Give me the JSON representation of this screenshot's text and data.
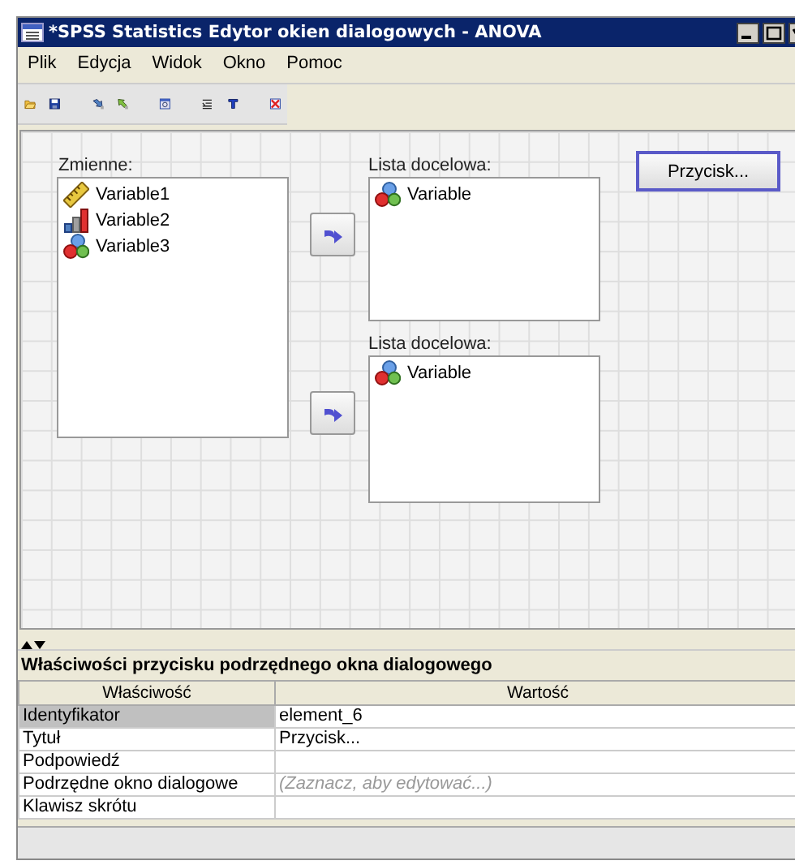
{
  "window": {
    "title": "*SPSS Statistics Edytor okien dialogowych - ANOVA"
  },
  "menu": [
    "Plik",
    "Edycja",
    "Widok",
    "Okno",
    "Pomoc"
  ],
  "canvas": {
    "source_list": {
      "label": "Zmienne:",
      "items": [
        {
          "text": "Variable1",
          "kind": "scale"
        },
        {
          "text": "Variable2",
          "kind": "ordinal"
        },
        {
          "text": "Variable3",
          "kind": "nominal"
        }
      ]
    },
    "target_lists": [
      {
        "label": "Lista docelowa:",
        "items": [
          {
            "text": "Variable",
            "kind": "nominal"
          }
        ]
      },
      {
        "label": "Lista docelowa:",
        "items": [
          {
            "text": "Variable",
            "kind": "nominal"
          }
        ]
      }
    ],
    "button": {
      "label": "Przycisk...",
      "selected": true
    }
  },
  "properties": {
    "title": "Właściwości przycisku podrzędnego okna dialogowego",
    "columns": [
      "Właściwość",
      "Wartość"
    ],
    "rows": [
      {
        "name": "Identyfikator",
        "value": "element_6",
        "selected": true
      },
      {
        "name": "Tytuł",
        "value": "Przycisk...",
        "selected": false
      },
      {
        "name": "Podpowiedź",
        "selected": false
      },
      {
        "name": "Podrzędne okno dialogowe",
        "value": "(Zaznacz, aby edytować...)",
        "kind": "hint",
        "selected": false
      },
      {
        "name": "Klawisz skrótu",
        "selected": false
      }
    ]
  }
}
